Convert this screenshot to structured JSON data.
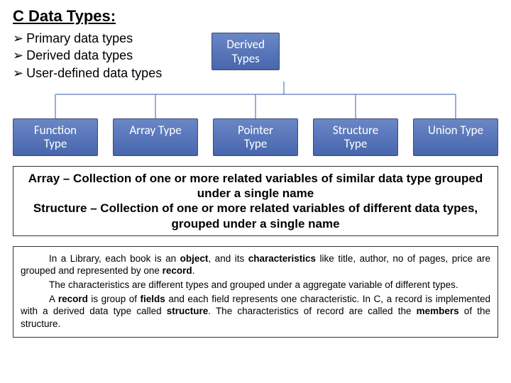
{
  "title": "C Data Types:",
  "bullets": [
    "Primary data types",
    "Derived data types",
    "User-defined data types"
  ],
  "diagram": {
    "root": "Derived\nTypes",
    "children": [
      "Function\nType",
      "Array Type",
      "Pointer\nType",
      "Structure\nType",
      "Union Type"
    ]
  },
  "definitions": {
    "array_label": "Array",
    "array_text": " – Collection of one or more related variables of similar data type grouped under a single name",
    "structure_label": "Structure",
    "structure_text": " – Collection of one or more related variables of different data types, grouped under a single name"
  },
  "paragraph": {
    "p1a": "In a Library, each book is an ",
    "p1b": "object",
    "p1c": ", and its ",
    "p1d": "characteristics",
    "p1e": " like title, author, no of pages, price are grouped and represented by one ",
    "p1f": "record",
    "p1g": ".",
    "p2": "The characteristics are different types and grouped under a aggregate variable of different types.",
    "p3a": "A ",
    "p3b": "record",
    "p3c": " is group of ",
    "p3d": "fields",
    "p3e": " and each field represents one characteristic. In C, a record is implemented with a derived data type called ",
    "p3f": "structure",
    "p3g": ". The characteristics of record are called the ",
    "p3h": "members",
    "p3i": " of the structure."
  }
}
